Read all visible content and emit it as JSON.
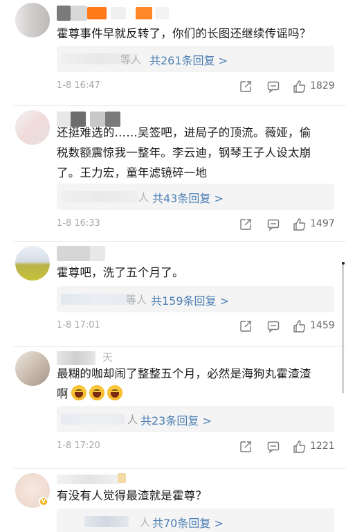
{
  "comments": [
    {
      "text": "霍尊事件早就反转了，你们的长图还继续传谣吗？",
      "reply_tail": "等人",
      "reply_link": "共261条回复 >",
      "timestamp": "1-8 16:47",
      "likes": "1829"
    },
    {
      "text_lines": [
        "还挺难选的……吴签吧，进局子的顶流。薇娅，偷",
        "税数额震惊我一整年。李云迪，钢琴王子人设太崩",
        "了。王力宏，童年滤镜碎一地"
      ],
      "reply_tail": "人",
      "reply_link": "共43条回复 >",
      "timestamp": "1-8 16:33",
      "likes": "1497"
    },
    {
      "text": "霍尊吧，洗了五个月了。",
      "reply_tail": "等人",
      "reply_link": "共159条回复 >",
      "timestamp": "1-8 17:01",
      "likes": "1459"
    },
    {
      "text_lines": [
        "最糊的咖却闹了整整五个月，必然是海狗丸霍渣渣",
        "啊"
      ],
      "name_fragment": "天",
      "reply_tail": "人",
      "reply_link": "共23条回复 >",
      "timestamp": "1-8 17:20",
      "likes": "1221"
    },
    {
      "text": "有没有人觉得最渣就是霍尊？",
      "reply_tail": "人",
      "reply_link": "共70条回复 >"
    }
  ],
  "icons": {
    "forward": "share-icon",
    "comment": "comment-icon",
    "like": "thumbs-up-icon"
  },
  "colors": {
    "link": "#4d7fb5",
    "meta": "#a6a6a6",
    "reply_bg": "#f4f4f4"
  }
}
